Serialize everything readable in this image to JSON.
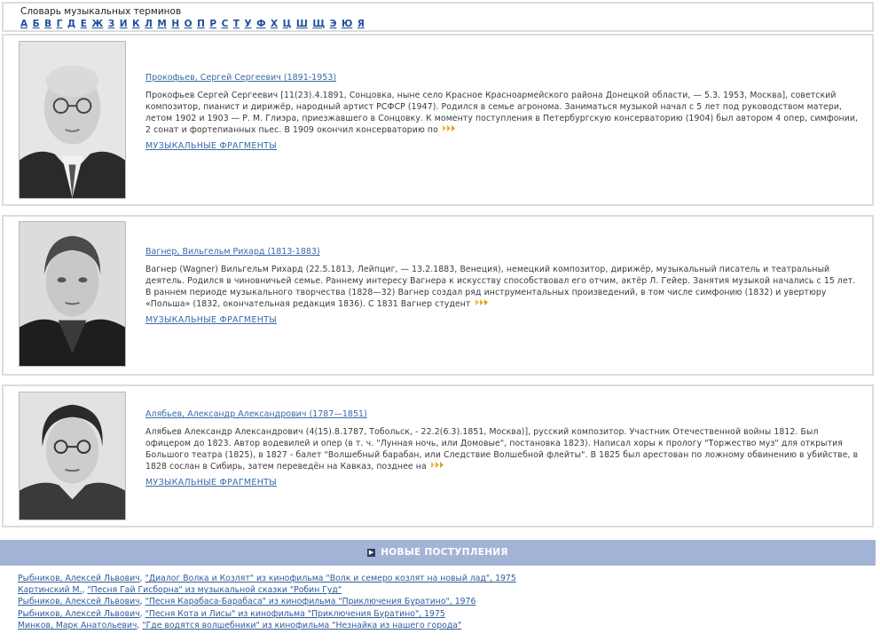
{
  "dictionary": {
    "title": "Словарь музыкальных терминов",
    "letters": [
      "А",
      "Б",
      "В",
      "Г",
      "Д",
      "Е",
      "Ж",
      "З",
      "И",
      "К",
      "Л",
      "М",
      "Н",
      "О",
      "П",
      "Р",
      "С",
      "Т",
      "У",
      "Ф",
      "Х",
      "Ц",
      "Ш",
      "Щ",
      "Э",
      "Ю",
      "Я"
    ]
  },
  "cards": [
    {
      "name": "Прокофьев, Сергей Сергеевич (1891-1953)",
      "bio": "Прокофьев Сергей Сергеевич [11(23).4.1891, Сонцовка, ныне село Красное Красноармейского района Донецкой области, — 5.3. 1953, Москва], советский композитор, пианист и дирижёр, народный артист РСФСР (1947). Родился в семье агронома. Заниматься музыкой начал с 5 лет под руководством матери, летом 1902 и 1903 — Р. М. Глиэра, приезжавшего в Сонцовку. К моменту поступления в Петербургскую консерваторию (1904) был автором 4 опер, симфонии, 2 сонат и фортепианных пьес. В 1909 окончил консерваторию по",
      "fragments": "МУЗЫКАЛЬНЫЕ ФРАГМЕНТЫ"
    },
    {
      "name": "Вагнер, Вильгельм Рихард (1813-1883)",
      "bio": "Вагнер (Wagner) Вильгельм Рихард (22.5.1813, Лейпциг, — 13.2.1883, Венеция), немецкий композитор, дирижёр, музыкальный писатель и театральный деятель. Родился в чиновничьей семье. Раннему интересу Вагнера к искусству способствовал его отчим, актёр Л. Гейер. Занятия музыкой начались с 15 лет. В раннем периоде музыкального творчества (1828—32) Вагнер создал ряд инструментальных произведений, в том числе симфонию (1832) и увертюру «Польша» (1832, окончательная редакция 1836). С 1831 Вагнер студент",
      "fragments": "МУЗЫКАЛЬНЫЕ ФРАГМЕНТЫ"
    },
    {
      "name": "Алябьев, Александр Александрович (1787—1851)",
      "bio": "Алябьев Александр Александрович (4(15).8.1787, Тобольск, - 22.2(6.3).1851, Москва)], русский композитор. Участник Отечественной войны 1812. Был офицером до 1823. Автор водевилей и опер (в т. ч. \"Лунная ночь, или Домовые\", постановка 1823). Написал хоры к прологу \"Торжество муз\" для открытия Большого театра (1825), в 1827 - балет \"Волшебный барабан, или Следствие Волшебной флейты\". В 1825 был арестован по ложному обвинению в убийстве, в 1828 сослан в Сибирь, затем переведён на Кавказ, позднее на",
      "fragments": "МУЗЫКАЛЬНЫЕ ФРАГМЕНТЫ"
    }
  ],
  "new_arrivals": {
    "title": "НОВЫЕ ПОСТУПЛЕНИЯ",
    "items": [
      {
        "author": "Рыбников, Алексей Львович",
        "work": "\"Диалог Волка и Козлят\" из кинофильма \"Волк и семеро козлят на новый лад\", 1975"
      },
      {
        "author": "Картинский М.",
        "work": "\"Песня Гай Гисборна\" из музыкальной сказки \"Робин Гуд\""
      },
      {
        "author": "Рыбников, Алексей Львович",
        "work": "\"Песня Карабаса-Барабаса\" из кинофильма \"Приключения Буратино\", 1976"
      },
      {
        "author": "Рыбников, Алексей Львович",
        "work": "\"Песня Кота и Лисы\" из кинофильма \"Приключения Буратино\", 1975"
      },
      {
        "author": "Минков, Марк Анатольевич",
        "work": "\"Где водятся волшебники\" из кинофильма \"Незнайка из нашего города\""
      }
    ]
  },
  "icons": {
    "more": "more-arrows-icon",
    "bar": "play-square-icon"
  },
  "colors": {
    "link": "#2e5c9a",
    "bar": "#a3b3d6",
    "border": "#dcdcdc"
  }
}
